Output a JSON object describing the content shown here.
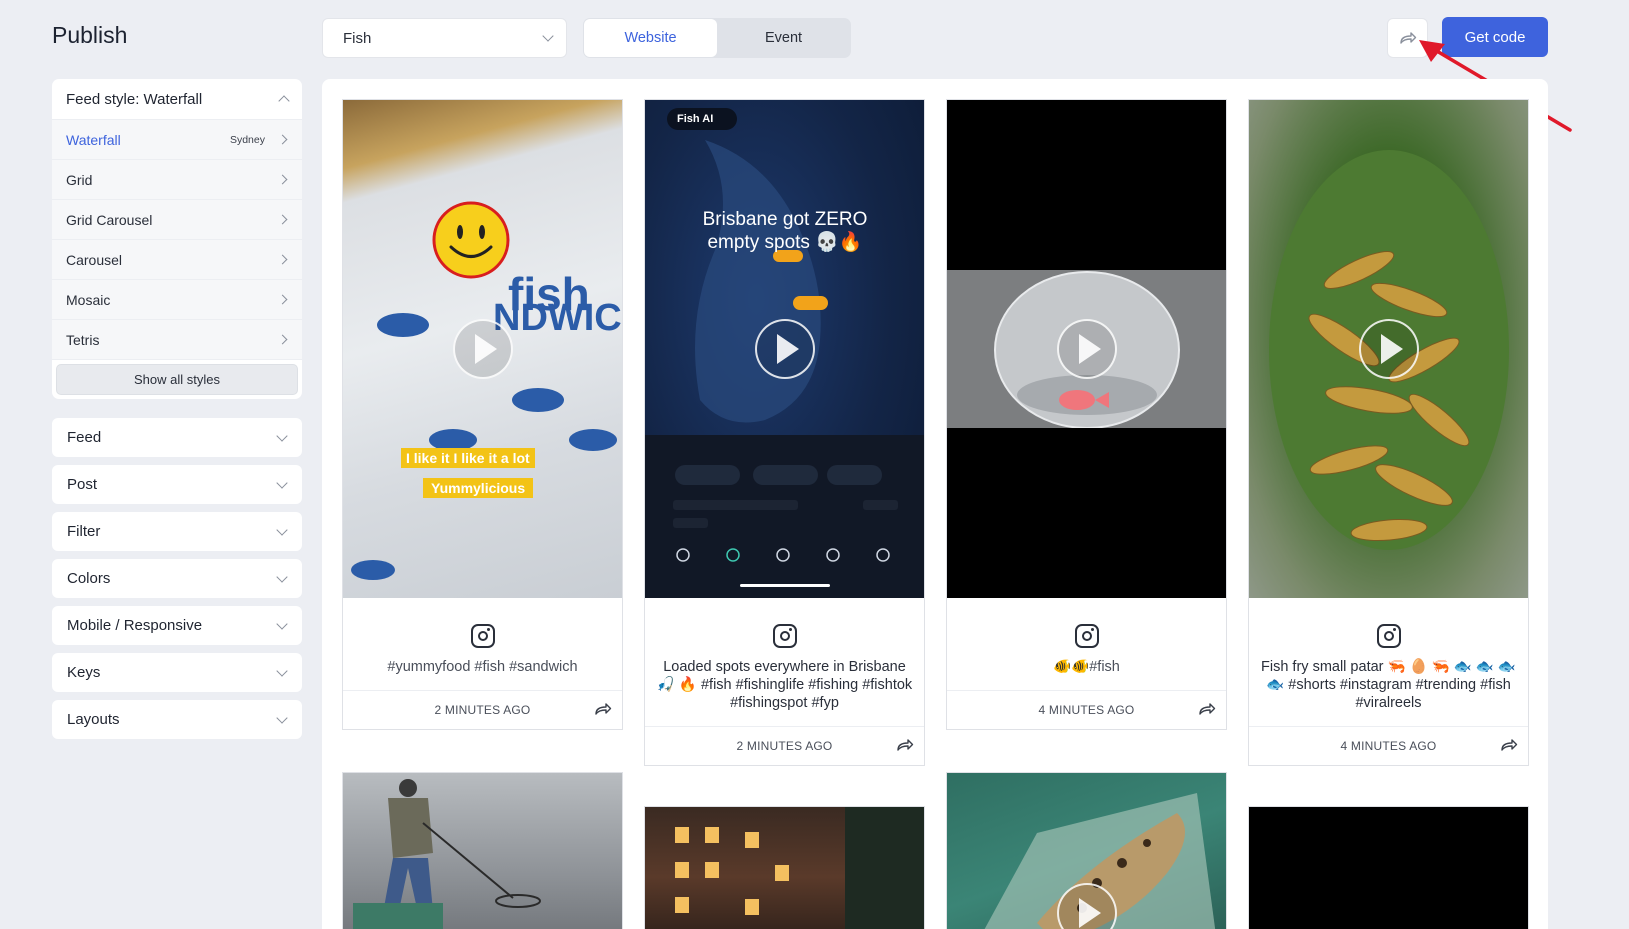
{
  "header": {
    "title": "Publish",
    "source_select": "Fish",
    "tabs": [
      {
        "label": "Website",
        "active": true
      },
      {
        "label": "Event",
        "active": false
      }
    ],
    "get_code": "Get code"
  },
  "sidebar": {
    "feed_style_header": "Feed style: Waterfall",
    "styles": [
      {
        "label": "Waterfall",
        "badge": "Sydney",
        "active": true
      },
      {
        "label": "Grid",
        "badge": ""
      },
      {
        "label": "Grid Carousel",
        "badge": ""
      },
      {
        "label": "Carousel",
        "badge": ""
      },
      {
        "label": "Mosaic",
        "badge": ""
      },
      {
        "label": "Tetris",
        "badge": ""
      }
    ],
    "show_all": "Show all styles",
    "sections": [
      "Feed",
      "Post",
      "Filter",
      "Colors",
      "Mobile / Responsive",
      "Keys",
      "Layouts"
    ]
  },
  "posts": [
    {
      "caption": "#yummyfood #fish #sandwich",
      "time": "2 MINUTES AGO",
      "overlay_1": "I like it I like it a lot",
      "overlay_2": "Yummylicious"
    },
    {
      "caption": "Loaded spots everywhere in Brisbane 🎣 🔥 #fish #fishinglife #fishing #fishtok #fishingspot #fyp",
      "time": "2 MINUTES AGO",
      "app_name": "Fish AI",
      "headline": "Brisbane got ZERO empty spots 💀🔥"
    },
    {
      "caption": "🐠🐠#fish",
      "time": "4 MINUTES AGO"
    },
    {
      "caption": "Fish fry small patar 🦐 🥚 🦐 🐟 🐟 🐟 🐟 #shorts #instagram #trending #fish #viralreels",
      "time": "4 MINUTES AGO"
    }
  ],
  "colors": {
    "accent": "#3e63dd",
    "arrow": "#e0192a"
  },
  "icons": {
    "share": "share-arrow-icon",
    "instagram": "instagram-icon",
    "play": "play-icon"
  }
}
